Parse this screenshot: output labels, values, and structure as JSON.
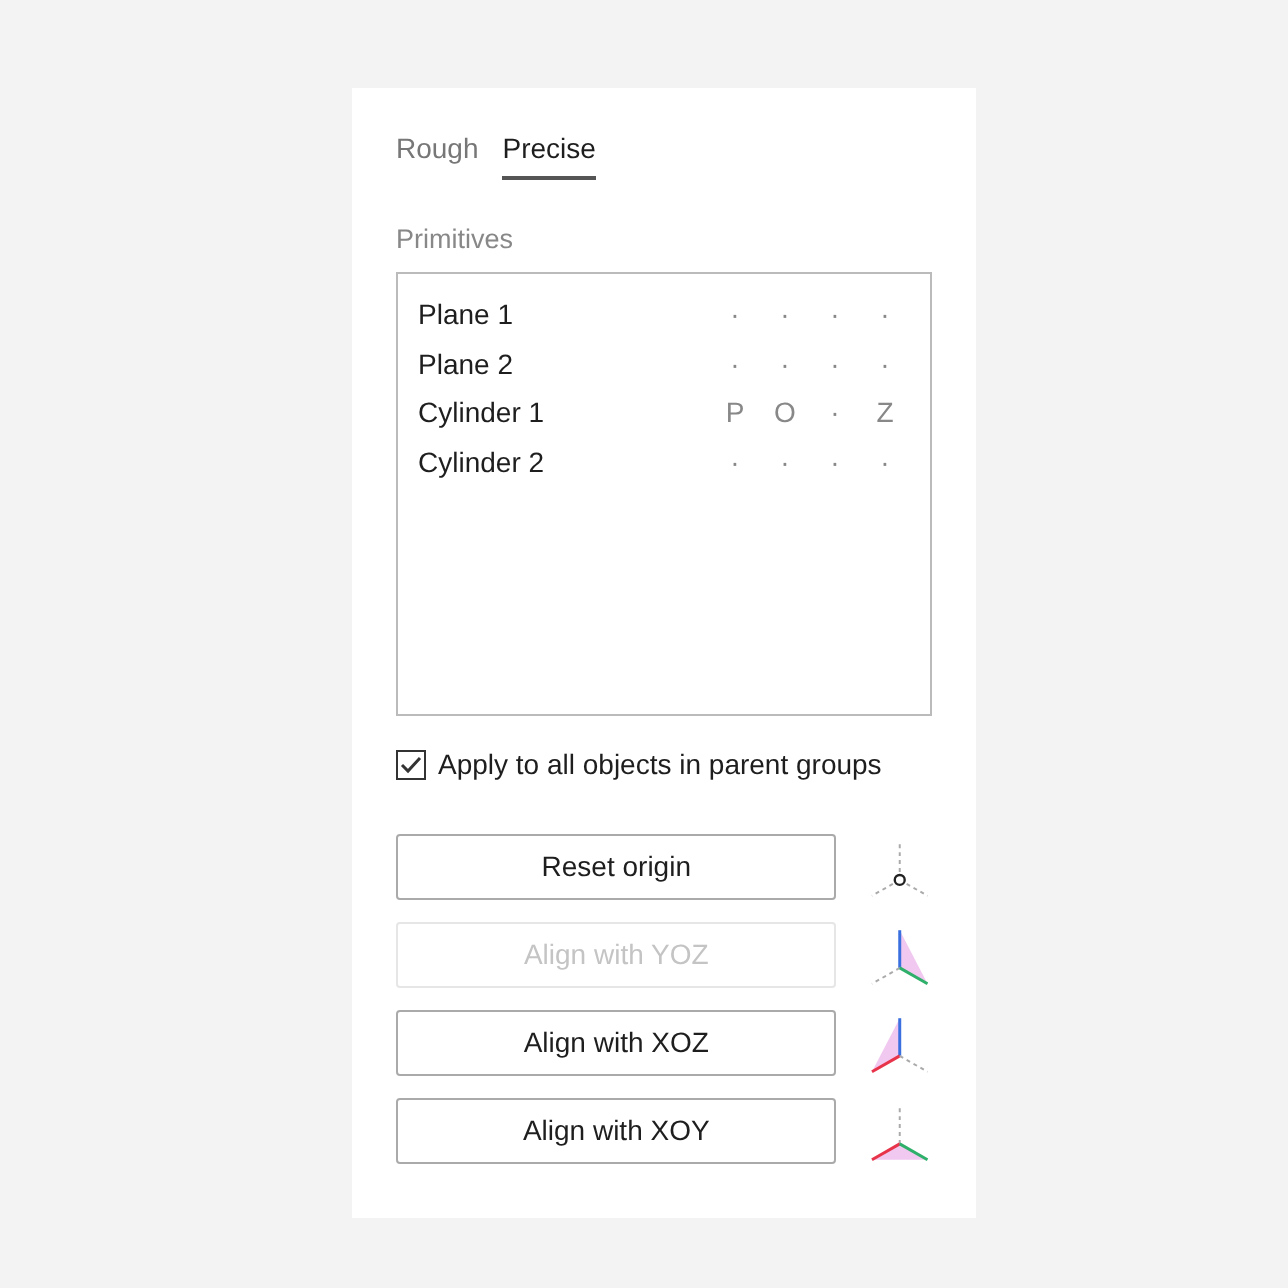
{
  "tabs": [
    {
      "label": "Rough",
      "selected": false
    },
    {
      "label": "Precise",
      "selected": true
    }
  ],
  "primitives": {
    "label": "Primitives",
    "items": [
      {
        "name": "Plane 1",
        "flags": [
          "·",
          "·",
          "·",
          "·"
        ]
      },
      {
        "name": "Plane 2",
        "flags": [
          "·",
          "·",
          "·",
          "·"
        ]
      },
      {
        "name": "Cylinder 1",
        "flags": [
          "P",
          "O",
          "·",
          "Z"
        ]
      },
      {
        "name": "Cylinder 2",
        "flags": [
          "·",
          "·",
          "·",
          "·"
        ]
      }
    ]
  },
  "apply_to_parents": {
    "label": "Apply to all objects in parent groups",
    "checked": true
  },
  "actions": [
    {
      "label": "Reset origin",
      "disabled": false,
      "kind": "origin"
    },
    {
      "label": "Align with YOZ",
      "disabled": true,
      "kind": "yoz"
    },
    {
      "label": "Align with XOZ",
      "disabled": false,
      "kind": "xoz"
    },
    {
      "label": "Align with XOY",
      "disabled": false,
      "kind": "xoy"
    }
  ]
}
